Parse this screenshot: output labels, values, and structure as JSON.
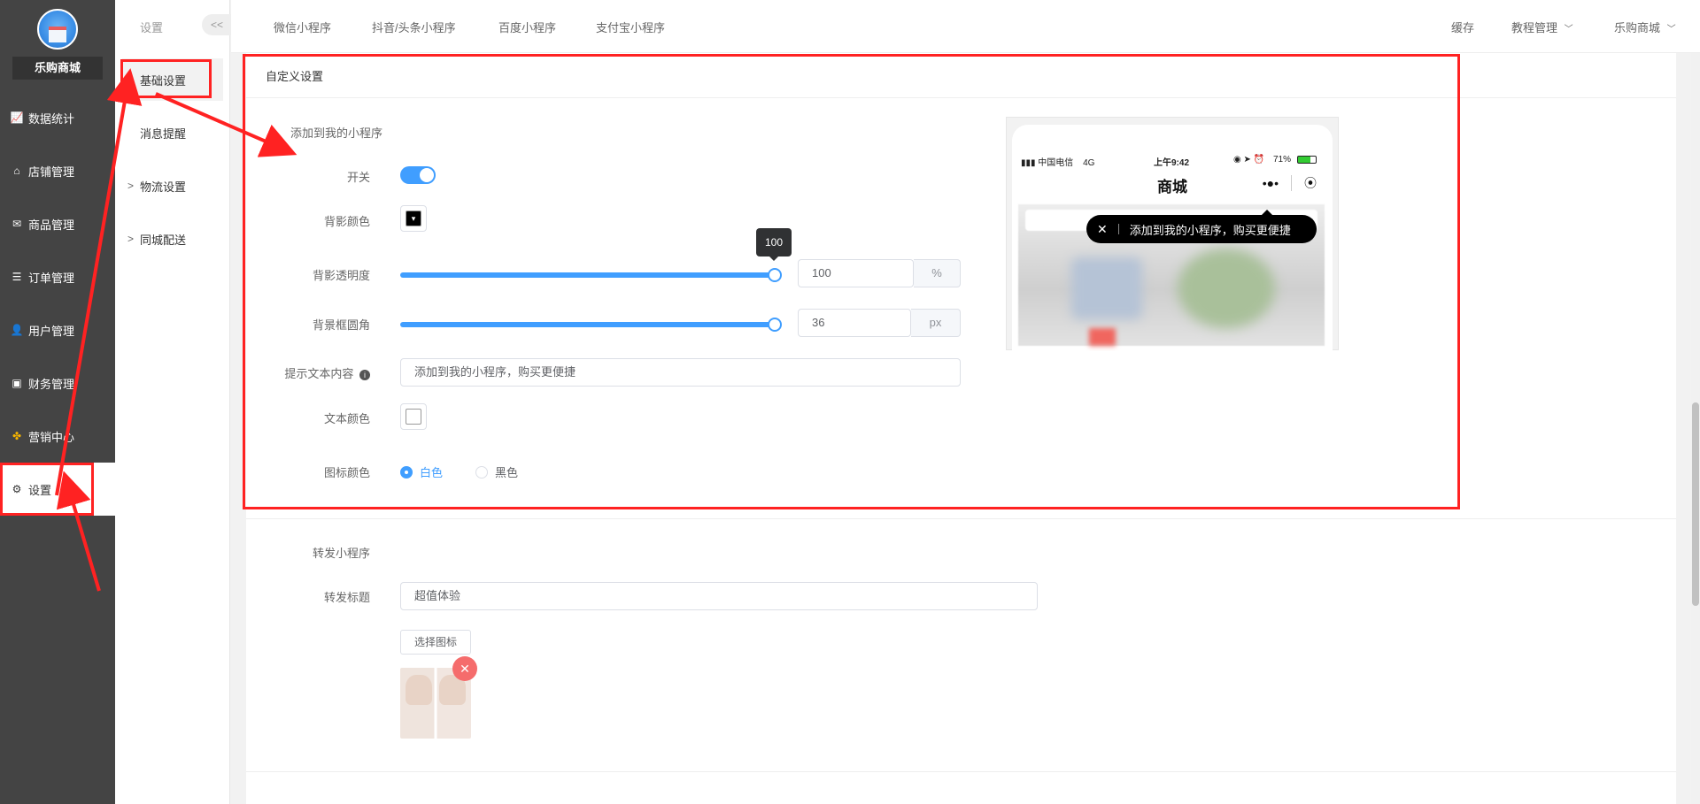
{
  "sidebar": {
    "shop_name": "乐购商城",
    "items": [
      {
        "label": "数据统计",
        "icon": "line-chart-icon"
      },
      {
        "label": "店铺管理",
        "icon": "store-icon"
      },
      {
        "label": "商品管理",
        "icon": "goods-icon"
      },
      {
        "label": "订单管理",
        "icon": "order-icon"
      },
      {
        "label": "用户管理",
        "icon": "user-icon"
      },
      {
        "label": "财务管理",
        "icon": "finance-icon"
      },
      {
        "label": "营销中心",
        "icon": "marketing-icon"
      },
      {
        "label": "设置",
        "icon": "gear-icon"
      }
    ]
  },
  "sub_sidebar": {
    "title": "设置",
    "collapse": "<<",
    "items": [
      {
        "label": "基础设置"
      },
      {
        "label": "消息提醒"
      },
      {
        "label": "物流设置",
        "chevron": ">"
      },
      {
        "label": "同城配送",
        "chevron": ">"
      }
    ]
  },
  "topbar": {
    "tabs": [
      "微信小程序",
      "抖音/头条小程序",
      "百度小程序",
      "支付宝小程序"
    ],
    "right": {
      "cache": "缓存",
      "tutorial": "教程管理",
      "shop": "乐购商城"
    }
  },
  "card": {
    "title": "自定义设置"
  },
  "add_section": {
    "title": "添加到我的小程序",
    "switch_label": "开关",
    "shadow_color_label": "背影颜色",
    "opacity_label": "背影透明度",
    "opacity_value": "100",
    "opacity_unit": "%",
    "opacity_level": 100,
    "radius_label": "背景框圆角",
    "radius_value": "36",
    "radius_unit": "px",
    "radius_level": 100,
    "tip_label": "提示文本内容",
    "tip_value": "添加到我的小程序，购买更便捷",
    "text_color_label": "文本颜色",
    "icon_color_label": "图标颜色",
    "icon_color_options": [
      "白色",
      "黑色"
    ],
    "icon_color_selected": "白色"
  },
  "preview": {
    "carrier": "中国电信",
    "network": "4G",
    "time": "上午9:42",
    "battery": "71%",
    "title": "商城",
    "bubble_text": "添加到我的小程序，购买更便捷"
  },
  "share_section": {
    "title": "转发小程序",
    "share_title_label": "转发标题",
    "share_title_value": "超值体验",
    "choose_icon_button": "选择图标"
  },
  "colors": {
    "accent": "#409eff",
    "annotation": "#ff2222",
    "sidebar_bg": "#444444"
  }
}
